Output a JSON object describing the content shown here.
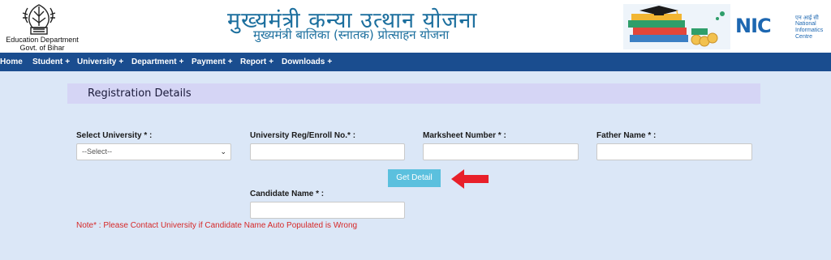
{
  "header": {
    "department_line1": "Education Department",
    "department_line2": "Govt. of Bihar",
    "title": "मुख्यमंत्री कन्या उत्थान योजना",
    "subtitle": "मुख्यमंत्री बालिका (स्नातक) प्रोत्साहन योजना",
    "nic": {
      "word": "NIC",
      "hindi": "एन आई सी",
      "line1": "National",
      "line2": "Informatics",
      "line3": "Centre"
    }
  },
  "nav": {
    "items": [
      {
        "label": "Home",
        "has_plus": false
      },
      {
        "label": "Student",
        "has_plus": true
      },
      {
        "label": "University",
        "has_plus": true
      },
      {
        "label": "Department",
        "has_plus": true
      },
      {
        "label": "Payment",
        "has_plus": true
      },
      {
        "label": "Report",
        "has_plus": true
      },
      {
        "label": "Downloads",
        "has_plus": true
      }
    ],
    "plus": "+"
  },
  "panel": {
    "title": "Registration Details"
  },
  "form": {
    "university_label": "Select University * :",
    "university_selected": "--Select--",
    "reg_label": "University Reg/Enroll No.* :",
    "reg_value": "",
    "marksheet_label": "Marksheet Number * :",
    "marksheet_value": "",
    "father_label": "Father Name * :",
    "father_value": "",
    "get_detail_label": "Get Detail",
    "candidate_label": "Candidate Name * :",
    "candidate_value": "",
    "note": "Note* : Please Contact University if Candidate Name Auto Populated is Wrong"
  },
  "colors": {
    "nav_bg": "#1a4d8f",
    "page_bg": "#dbe7f7",
    "button_bg": "#5bc0de",
    "note_text": "#d62828",
    "arrow": "#e8202a",
    "title_blue": "#1c6f9e"
  }
}
